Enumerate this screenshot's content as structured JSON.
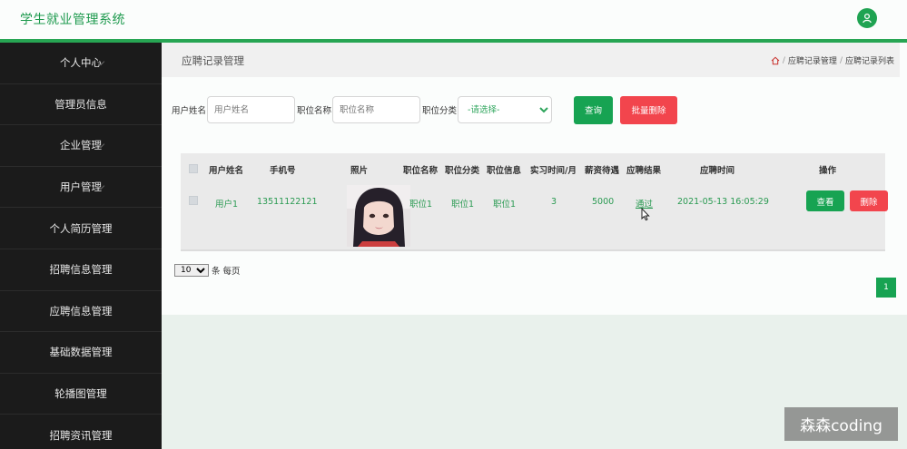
{
  "app": {
    "title": "学生就业管理系统"
  },
  "sidebar": {
    "items": [
      {
        "label": "个人中心",
        "caret": true
      },
      {
        "label": "管理员信息",
        "caret": false
      },
      {
        "label": "企业管理",
        "caret": true
      },
      {
        "label": "用户管理",
        "caret": true
      },
      {
        "label": "个人简历管理",
        "caret": false
      },
      {
        "label": "招聘信息管理",
        "caret": false
      },
      {
        "label": "应聘信息管理",
        "caret": false
      },
      {
        "label": "基础数据管理",
        "caret": false
      },
      {
        "label": "轮播图管理",
        "caret": false
      },
      {
        "label": "招聘资讯管理",
        "caret": false
      }
    ]
  },
  "page": {
    "title": "应聘记录管理",
    "breadcrumb": [
      "应聘记录管理",
      "应聘记录列表"
    ]
  },
  "search": {
    "username_label": "用户姓名",
    "username_placeholder": "用户姓名",
    "position_label": "职位名称",
    "position_placeholder": "职位名称",
    "category_label": "职位分类",
    "category_selected": "-请选择-",
    "query_button": "查询",
    "batch_delete_button": "批量删除"
  },
  "table": {
    "headers": [
      "用户姓名",
      "手机号",
      "照片",
      "职位名称",
      "职位分类",
      "职位信息",
      "实习时间/月",
      "薪资待遇",
      "应聘结果",
      "应聘时间",
      "操作"
    ],
    "rows": [
      {
        "username": "用户1",
        "phone": "13511122121",
        "position_name": "职位1",
        "position_category": "职位1",
        "position_info": "职位1",
        "internship_months": "3",
        "salary": "5000",
        "result": "通过",
        "apply_time": "2021-05-13 16:05:29",
        "view_button": "查看",
        "delete_button": "删除"
      }
    ]
  },
  "pagination": {
    "page_size": "10",
    "page_size_suffix": "条 每页",
    "current_page": "1"
  },
  "watermark": "森森coding",
  "colors": {
    "brand_green": "#17a352",
    "danger_red": "#f2454d",
    "sidebar_bg": "#1b1b1b"
  }
}
